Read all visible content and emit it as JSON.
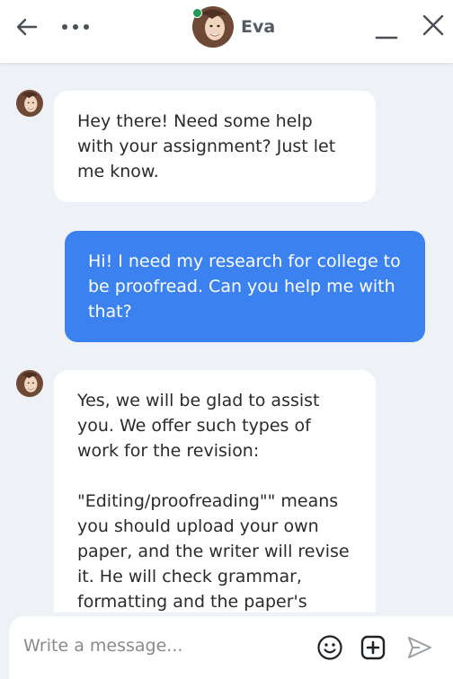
{
  "header": {
    "contact_name": "Eva",
    "status": "online",
    "status_color": "#1f9d55"
  },
  "messages": [
    {
      "direction": "incoming",
      "text": "Hey there! Need some help with your assignment? Just let me know."
    },
    {
      "direction": "outgoing",
      "text": "Hi! I need my research for college to be proofread. Can you help me with that?"
    },
    {
      "direction": "incoming",
      "text": "Yes, we will be glad to assist you. We offer such types of work for the revision:\n\n\"Editing/proofreading\"\" means you should upload your own paper, and the writer will revise it. He will check grammar, formatting and the paper's"
    }
  ],
  "composer": {
    "placeholder": "Write a message..."
  },
  "icons": {
    "back": "arrow-left-icon",
    "more": "more-dots-icon",
    "minimize": "minimize-icon",
    "close": "close-icon",
    "emoji": "smiley-icon",
    "attach": "plus-square-icon",
    "send": "send-icon"
  },
  "colors": {
    "outgoing_bubble": "#3b82f0",
    "incoming_bubble": "#ffffff",
    "background": "#eef1f5"
  }
}
